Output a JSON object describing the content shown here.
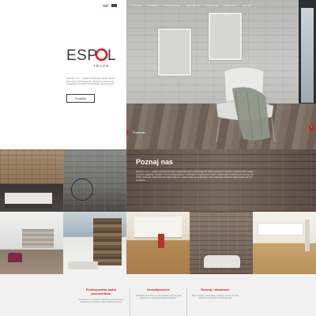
{
  "nav": {
    "items": [
      "O NAS",
      "OFERTA",
      "INSPIRACJE",
      "PROJEKTY",
      "GALERIA",
      "KONTAKT",
      "SKLEP"
    ],
    "languages": [
      "pl",
      "en"
    ]
  },
  "brand": {
    "name": "ESPOL",
    "sub": "TRADE",
    "accent_color": "#c8232c"
  },
  "intro": {
    "text": "Espol sp. z o.o. – wyłączny dystrybutor płytek i paneli ściennych w technologii 3D. Oferujemy nowoczesne rozwiązania do wnętrz mieszkalnych i komercyjnych.",
    "button_label": "Produkty"
  },
  "hero": {
    "caption": "Poznaj nas"
  },
  "about": {
    "title": "Poznaj nas",
    "text": "Espol sp. z o.o. – wyłączny dystrybutor płytek i paneli ściennych w technologii 3D. Nasze produkty to naturalne materiały, które nadają wnętrzom wyjątkowy charakter. Od lat współpracujemy z architektami i projektantami wnętrz, dostarczając rozwiązania do domów, biur, hoteli i restauracji. Zapraszamy do zapoznania się z naszą ofertą oraz realizacjami, które pokazują możliwości zastosowania naszych produktów."
  },
  "features": [
    {
      "title": "Profesjonalna kadra pracowników",
      "text": "Doświadczeni, wyszkoleni pracownicy służą pomocą i doradztwem na każdym etapie realizacji projektu."
    },
    {
      "title": "Doświadczenie",
      "text": "Wieloletnia obecność na rynku pozwala nam oferować sprawdzone rozwiązania najwyższej jakości."
    },
    {
      "title": "Rozwój i otwartość",
      "text": "Stale rozwijamy naszą ofertę i jesteśmy otwarci na nowe pomysły oraz potrzeby naszych klientów."
    }
  ],
  "icons": {
    "hero_prev": "arrow-left-icon",
    "hero_next": "arrow-right-icon"
  }
}
